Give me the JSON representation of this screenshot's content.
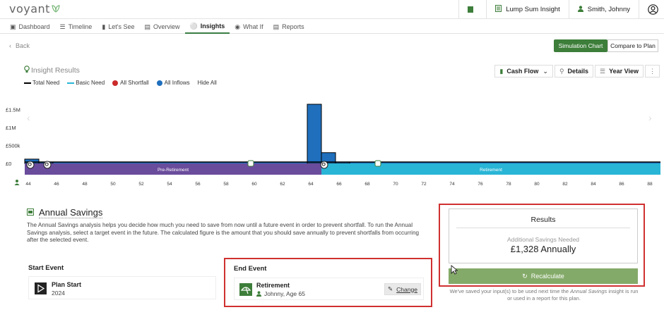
{
  "app": {
    "logo_text": "voyant",
    "top_right": {
      "lump_sum": "Lump Sum Insight",
      "client": "Smith, Johnny"
    }
  },
  "tabs": [
    {
      "label": "Dashboard",
      "icon": "dashboard-icon"
    },
    {
      "label": "Timeline",
      "icon": "timeline-icon"
    },
    {
      "label": "Let's See",
      "icon": "bar-chart-icon"
    },
    {
      "label": "Overview",
      "icon": "document-icon"
    },
    {
      "label": "Insights",
      "icon": "lightbulb-icon",
      "active": true
    },
    {
      "label": "What If",
      "icon": "question-icon"
    },
    {
      "label": "Reports",
      "icon": "report-icon"
    }
  ],
  "nav": {
    "back": "Back"
  },
  "buttons": {
    "simulation_chart": "Simulation Chart",
    "compare_to_plan": "Compare to Plan"
  },
  "insight_results": {
    "title": "Insight Results"
  },
  "legend": [
    {
      "label": "Total Need",
      "color": "#000000",
      "type": "line"
    },
    {
      "label": "Basic Need",
      "color": "#29b5d6",
      "type": "line"
    },
    {
      "label": "All Shortfall",
      "color": "#cc2b2b",
      "type": "dot"
    },
    {
      "label": "All Inflows",
      "color": "#1f6fbd",
      "type": "dot"
    },
    {
      "label": "Hide All",
      "type": "action"
    }
  ],
  "chart_tools": {
    "cash_flow": "Cash Flow",
    "details": "Details",
    "year_view": "Year View"
  },
  "chart_data": {
    "type": "bar",
    "y_ticks": [
      "£1.5M",
      "£1M",
      "£500k",
      "£0"
    ],
    "ylim": [
      0,
      1600000
    ],
    "x_ticks": [
      "44",
      "46",
      "48",
      "50",
      "52",
      "54",
      "56",
      "58",
      "60",
      "62",
      "64",
      "66",
      "68",
      "70",
      "72",
      "74",
      "76",
      "78",
      "80",
      "82",
      "84",
      "86",
      "88"
    ],
    "x_range": [
      44,
      89
    ],
    "series": [
      {
        "color": "#1f6fbd",
        "points": [
          {
            "age": 44,
            "value": 120000
          },
          {
            "age": 45,
            "value": 40000
          },
          {
            "age": 64,
            "value": 1650000
          },
          {
            "age": 65,
            "value": 300000
          },
          {
            "age": 66,
            "value": 40000
          }
        ],
        "baseline": 40000
      }
    ],
    "total_need_line": 40000,
    "phases": [
      {
        "label": "Pre-Retirement",
        "from": 44,
        "to": 65,
        "color": "#6a4c9c"
      },
      {
        "label": "Retirement",
        "from": 65,
        "to": 89,
        "color": "#29b5d6"
      }
    ]
  },
  "annual_savings": {
    "title": "Annual Savings",
    "description": "The Annual Savings analysis helps you decide how much you need to save from now until a future event in order to prevent shortfall. To run the Annual Savings analysis, select a target event in the future. The calculated figure is the amount that you should save annually to prevent shortfalls from occurring after the selected event."
  },
  "start_event": {
    "label": "Start Event",
    "title": "Plan Start",
    "sub": "2024"
  },
  "end_event": {
    "label": "End Event",
    "title": "Retirement",
    "sub": "Johnny, Age 65",
    "change": "Change"
  },
  "results": {
    "title": "Results",
    "sub": "Additional Savings Needed",
    "value": "£1,328 Annually",
    "recalculate": "Recalculate",
    "note_pre": "We've saved your input(s) to be used next time the ",
    "note_italic": "Annual Savings",
    "note_post": " insight is run or used in a report for this plan."
  }
}
